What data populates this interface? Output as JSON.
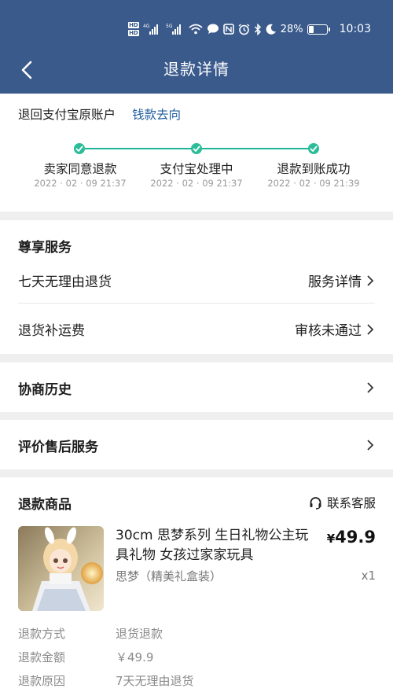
{
  "status_bar": {
    "hd_top": "HD",
    "hd_bottom": "HD",
    "net1": "4G",
    "net2": "5G",
    "battery_percent": "28%",
    "battery_level": 0.28,
    "time": "10:03"
  },
  "header": {
    "title": "退款详情"
  },
  "refund_route": {
    "text": "退回支付宝原账户",
    "link": "钱款去向"
  },
  "progress": {
    "color": "#1fb39a",
    "steps": [
      {
        "label": "卖家同意退款",
        "time": "2022 · 02 · 09 21:37"
      },
      {
        "label": "支付宝处理中",
        "time": "2022 · 02 · 09 21:37"
      },
      {
        "label": "退款到账成功",
        "time": "2022 · 02 · 09 21:39"
      }
    ]
  },
  "premium": {
    "title": "尊享服务",
    "rows": [
      {
        "label": "七天无理由退货",
        "value": "服务详情"
      },
      {
        "label": "退货补运费",
        "value": "审核未通过"
      }
    ]
  },
  "history": {
    "label": "协商历史"
  },
  "review": {
    "label": "评价售后服务"
  },
  "refund_item": {
    "title": "退款商品",
    "service_link": "联系客服",
    "product_title": "30cm 思梦系列 生日礼物公主玩具礼物 女孩过家家玩具",
    "sku": "思梦（精美礼盒装）",
    "price_symbol": "¥",
    "price": "49.9",
    "qty": "x1"
  },
  "details": [
    {
      "label": "退款方式",
      "value": "退货退款"
    },
    {
      "label": "退款金额",
      "value": "￥49.9"
    },
    {
      "label": "退款原因",
      "value": "7天无理由退货"
    }
  ],
  "colors": {
    "header_bg": "#3a5a8c",
    "link": "#1e5a9c",
    "success": "#1fb39a"
  }
}
